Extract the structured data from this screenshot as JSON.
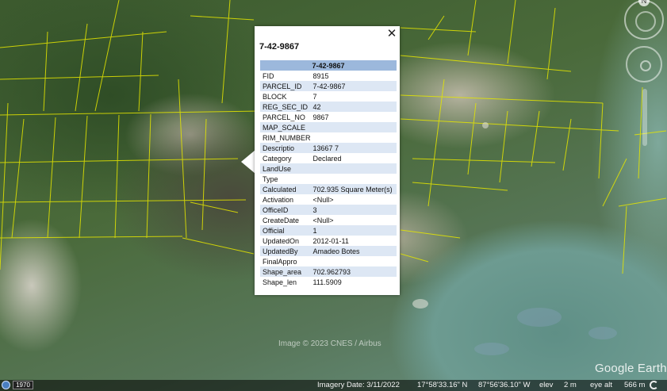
{
  "popup": {
    "title": "7-42-9867",
    "table_header": "7-42-9867",
    "rows": [
      {
        "key": "FID",
        "value": "8915"
      },
      {
        "key": "PARCEL_ID",
        "value": "7-42-9867"
      },
      {
        "key": "BLOCK",
        "value": "7"
      },
      {
        "key": "REG_SEC_ID",
        "value": "42"
      },
      {
        "key": "PARCEL_NO",
        "value": "9867"
      },
      {
        "key": "MAP_SCALE",
        "value": ""
      },
      {
        "key": "RIM_NUMBER",
        "value": ""
      },
      {
        "key": "Descriptio",
        "value": "13667 7"
      },
      {
        "key": "Category",
        "value": "Declared"
      },
      {
        "key": "LandUse",
        "value": ""
      },
      {
        "key": "Type",
        "value": ""
      },
      {
        "key": "Calculated",
        "value": "702.935 Square Meter(s)"
      },
      {
        "key": "Activation",
        "value": "<Null>"
      },
      {
        "key": "OfficeID",
        "value": "3"
      },
      {
        "key": "CreateDate",
        "value": "<Null>"
      },
      {
        "key": "Official",
        "value": "1"
      },
      {
        "key": "UpdatedOn",
        "value": "2012-01-11"
      },
      {
        "key": "UpdatedBy",
        "value": "Amadeo Botes"
      },
      {
        "key": "FinalAppro",
        "value": ""
      },
      {
        "key": "Shape_area",
        "value": "702.962793"
      },
      {
        "key": "Shape_len",
        "value": "111.5909"
      }
    ],
    "close_glyph": "✕"
  },
  "map": {
    "copyright": "Image © 2023 CNES / Airbus",
    "brand": "Google Earth",
    "compass_letter": "N"
  },
  "statusbar": {
    "year": "1970",
    "imagery_date": "Imagery Date: 3/11/2022",
    "lat": "17°58'33.16\" N",
    "lon": "87°56'36.10\" W",
    "elev_label": "elev",
    "elev_value": "2 m",
    "eye_alt_label": "eye alt",
    "eye_alt_value": "566 m"
  },
  "colors": {
    "parcel_lines": "#e5e600",
    "table_header_bg": "#9cb8dc",
    "table_stripe_bg": "#dde7f4",
    "water": "#6d9b91"
  },
  "icons": [
    "compass-icon",
    "look-joystick-icon",
    "zoom-slider",
    "historical-imagery-icon",
    "streaming-icon",
    "close-icon"
  ]
}
